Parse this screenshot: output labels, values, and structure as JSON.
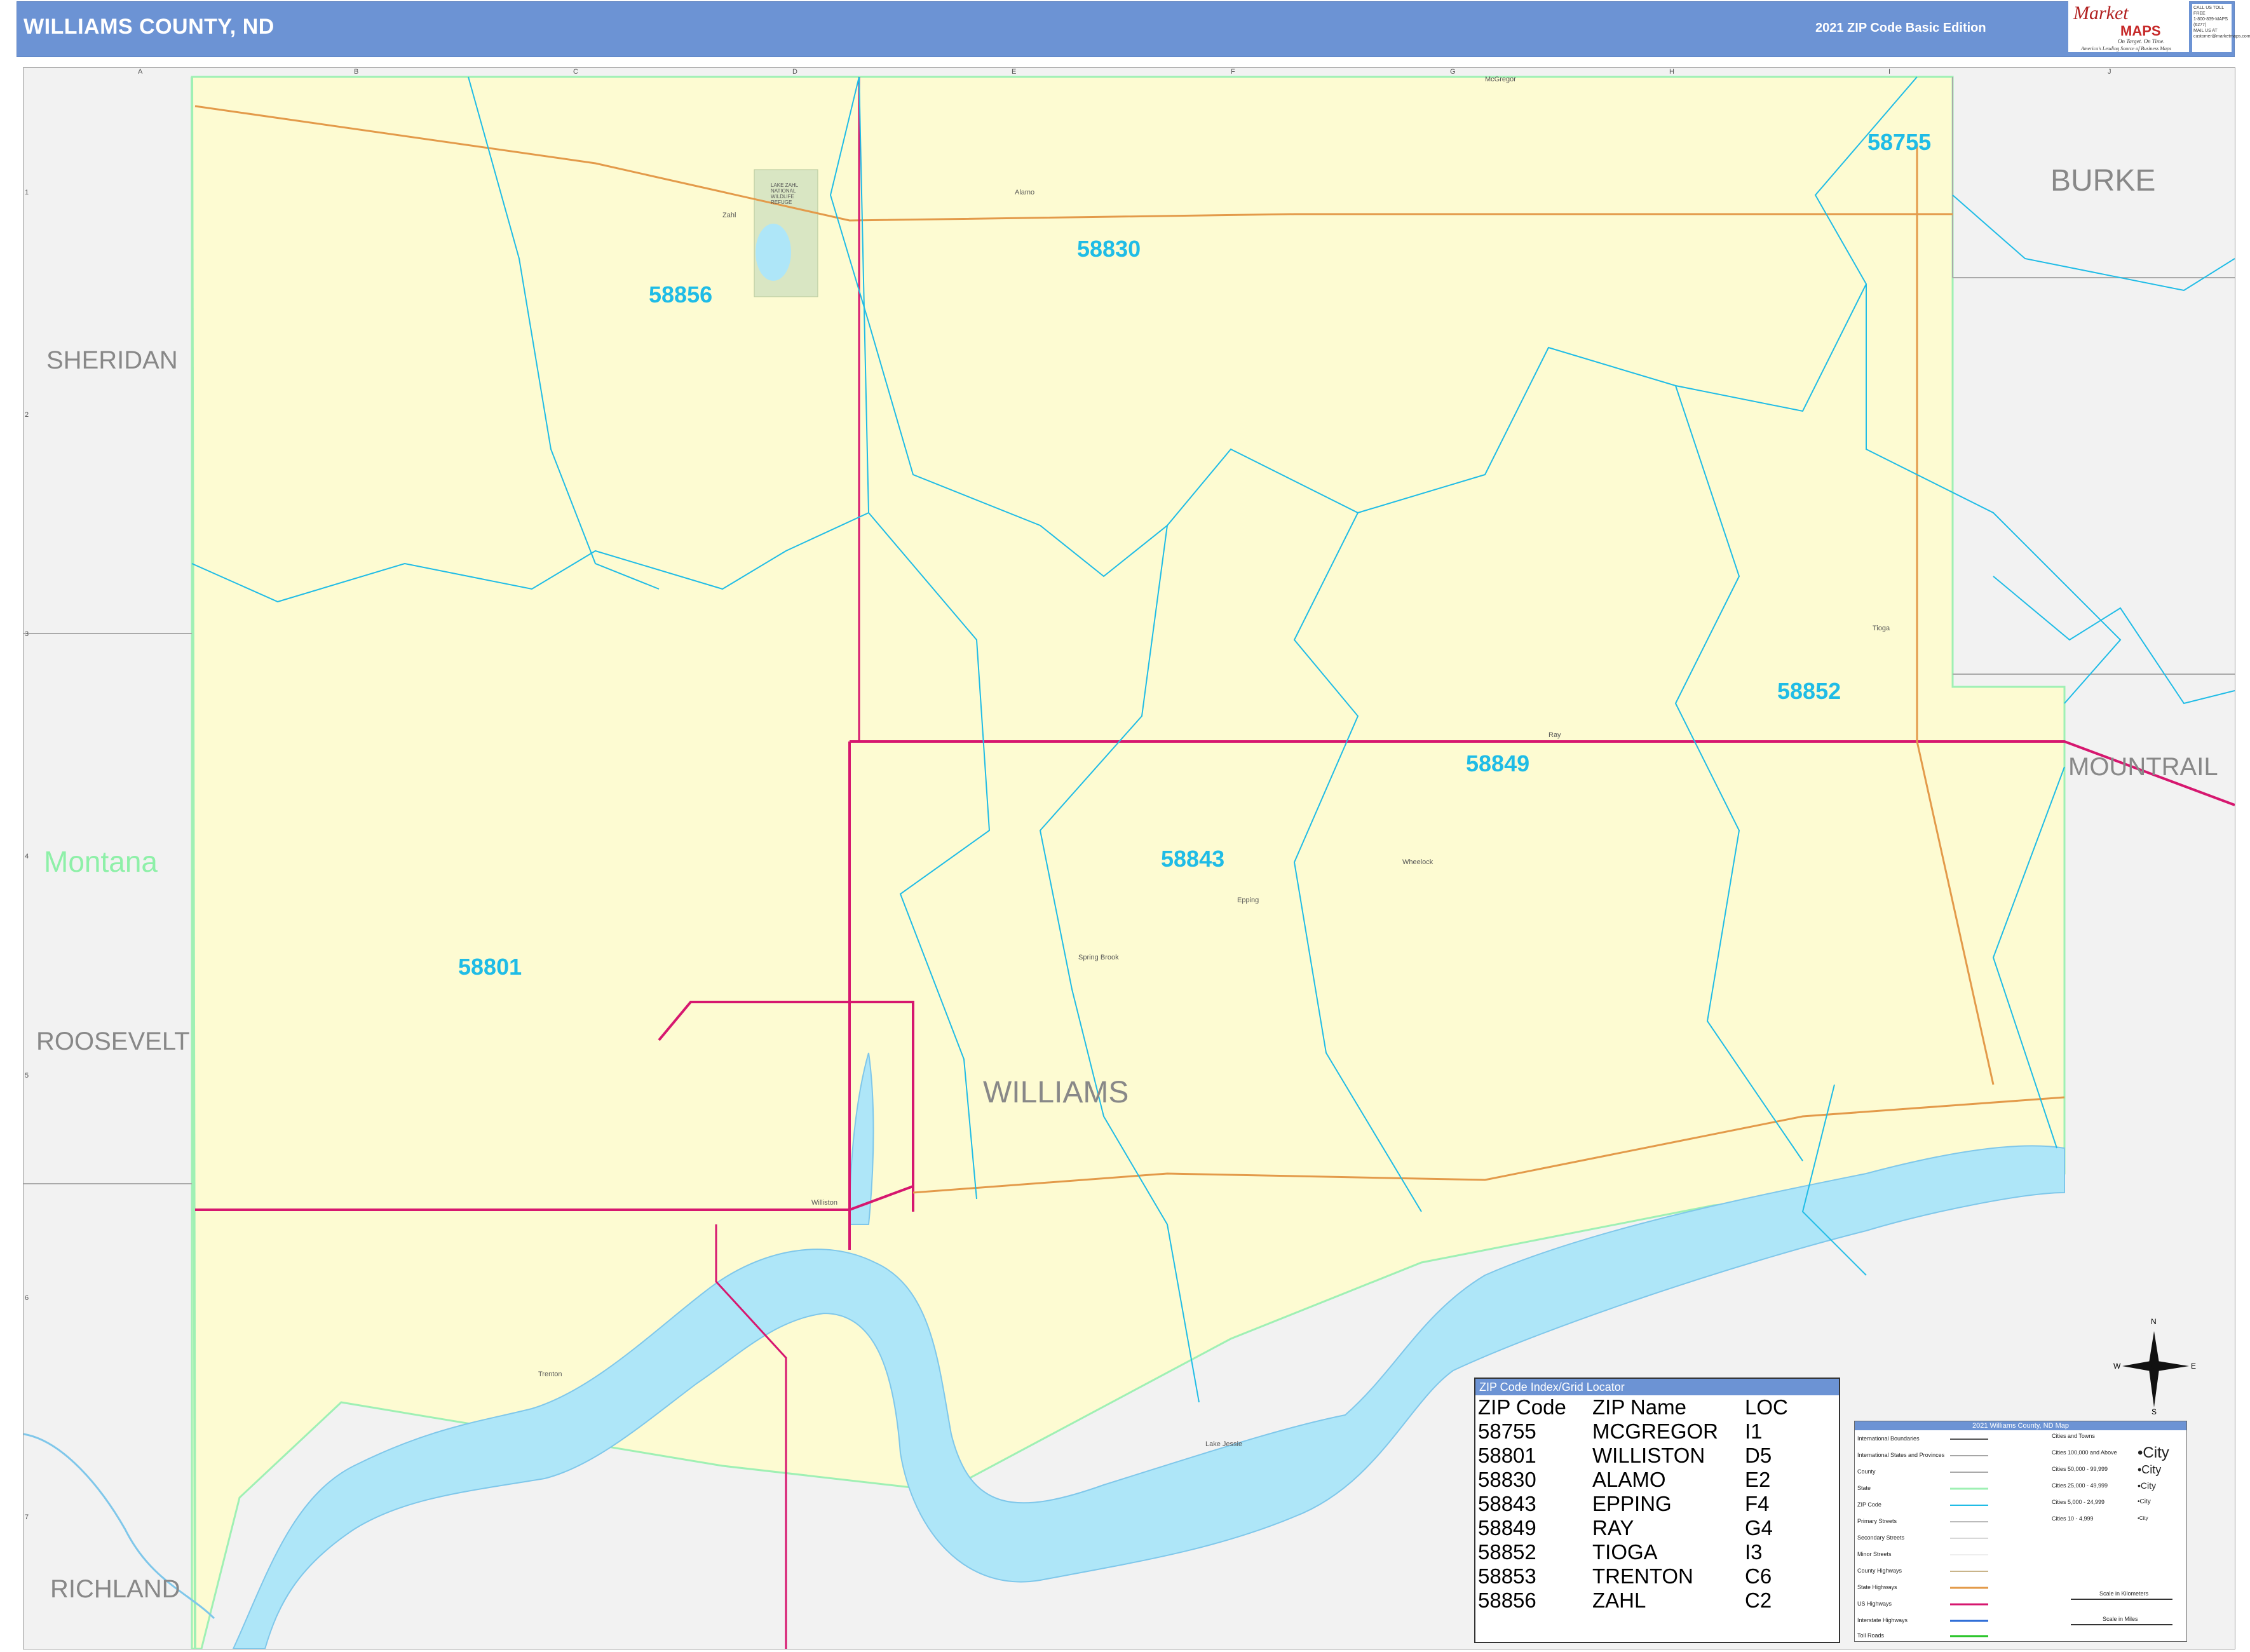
{
  "header": {
    "title": "WILLIAMS COUNTY, ND",
    "edition": "2021 ZIP Code Basic Edition",
    "logo_line1": "Market",
    "logo_line2": "MAPS",
    "logo_tag1": "On Target. On Time.",
    "logo_tag2": "America's Leading Source of Business Maps",
    "contact_lines": [
      "CALL US TOLL FREE",
      "1-800-839-MAPS (6277)",
      "MAIL US AT",
      "customer@marketmaps.com"
    ]
  },
  "grid": {
    "columns": [
      "A",
      "B",
      "C",
      "D",
      "E",
      "F",
      "G",
      "H",
      "I",
      "J"
    ],
    "rows": [
      "1",
      "2",
      "3",
      "4",
      "5",
      "6",
      "7"
    ]
  },
  "counties": {
    "center": "WILLIAMS",
    "sheridan": "SHERIDAN",
    "montana": "Montana",
    "roosevelt": "ROOSEVELT",
    "richland": "RICHLAND",
    "burke": "BURKE",
    "mountrail": "MOUNTRAIL"
  },
  "zips_on_map": [
    "58755",
    "58830",
    "58856",
    "58852",
    "58849",
    "58843",
    "58801"
  ],
  "places": {
    "alamo": "Alamo",
    "mcgregor": "McGregor",
    "zahl": "Zahl",
    "tioga": "Tioga",
    "ray": "Ray",
    "epping": "Epping",
    "spring_brook": "Spring Brook",
    "wheelock": "Wheelock",
    "williston": "Williston",
    "trenton": "Trenton",
    "lake_zahl": "LAKE ZAHL NATIONAL WILDLIFE REFUGE",
    "lake_jessie": "Lake Jessie"
  },
  "zip_index": {
    "title": "ZIP Code Index/Grid Locator",
    "columns": [
      "ZIP Code",
      "ZIP Name",
      "LOC"
    ],
    "rows": [
      [
        "58755",
        "MCGREGOR",
        "I1"
      ],
      [
        "58801",
        "WILLISTON",
        "D5"
      ],
      [
        "58830",
        "ALAMO",
        "E2"
      ],
      [
        "58843",
        "EPPING",
        "F4"
      ],
      [
        "58849",
        "RAY",
        "G4"
      ],
      [
        "58852",
        "TIOGA",
        "I3"
      ],
      [
        "58853",
        "TRENTON",
        "C6"
      ],
      [
        "58856",
        "ZAHL",
        "C2"
      ]
    ]
  },
  "legend": {
    "title": "2021 Williams County, ND Map",
    "items": [
      "International Boundaries",
      "International States and Provinces",
      "County",
      "State",
      "ZIP Code",
      "Primary Streets",
      "Secondary Streets",
      "Minor Streets",
      "County Highways",
      "State Highways",
      "US Highways",
      "Interstate Highways",
      "Toll Roads"
    ],
    "cities_title": "Cities and Towns",
    "cities": [
      {
        "range": "Cities 100,000 and Above",
        "sample": "•City"
      },
      {
        "range": "Cities 50,000 - 99,999",
        "sample": "•City"
      },
      {
        "range": "Cities 25,000 - 49,999",
        "sample": "•City"
      },
      {
        "range": "Cities 5,000 - 24,999",
        "sample": "•City"
      },
      {
        "range": "Cities 10 - 4,999",
        "sample": "•City"
      }
    ],
    "scale_km": "Scale in Kilometers",
    "scale_mi": "Scale in Miles"
  },
  "compass": {
    "n": "N",
    "s": "S",
    "e": "E",
    "w": "W"
  },
  "colors": {
    "header": "#6c93d4",
    "county_fill": "#fdfbd2",
    "water": "#aee6f8",
    "zip_line": "#1fbce6",
    "us_highway": "#d6176f",
    "state_highway": "#e39a4a",
    "state_border": "#9ff0b4"
  }
}
